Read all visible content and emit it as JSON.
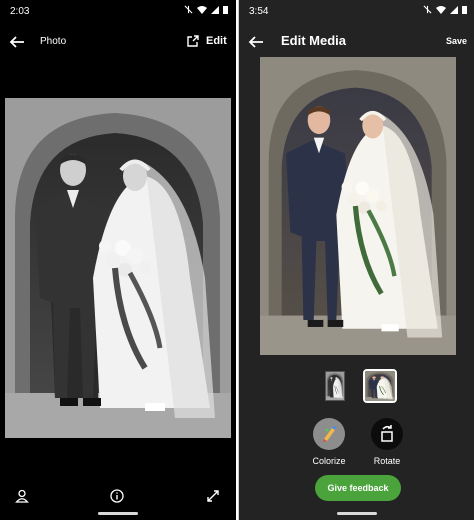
{
  "left_screen": {
    "status_time": "2:03",
    "title": "Photo",
    "edit_label": "Edit",
    "icons": [
      "back-arrow-icon",
      "share-icon",
      "person-icon",
      "info-icon",
      "expand-icon"
    ]
  },
  "right_screen": {
    "status_time": "3:54",
    "title": "Edit Media",
    "save_label": "Save",
    "tools": [
      {
        "label": "Colorize",
        "icon": "colorize-icon"
      },
      {
        "label": "Rotate",
        "icon": "rotate-icon"
      }
    ],
    "feedback_label": "Give feedback"
  },
  "colors": {
    "left_background": "#000000",
    "right_background": "#232323",
    "feedback_button": "#4aa33b",
    "selected_thumbnail_border": "#ffffff"
  }
}
